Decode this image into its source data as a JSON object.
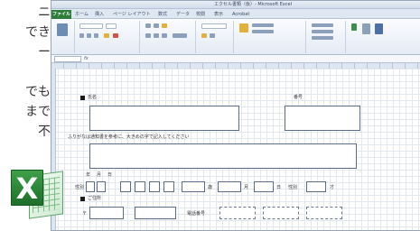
{
  "article": {
    "lines": [
      "ニ",
      "でき",
      "ー",
      "でも",
      "まで",
      "不"
    ]
  },
  "window": {
    "title": "エクセル書類（仮）- Microsoft Excel"
  },
  "ribbon_tabs": [
    "ファイル",
    "ホーム",
    "挿入",
    "ページ レイアウト",
    "数式",
    "データ",
    "校閲",
    "表示",
    "Acrobat"
  ],
  "form": {
    "section_name": "氏名",
    "section_number": "番号",
    "note": "ふりがなは通知書を参考に、大きめの字で記入してください",
    "date_labels": [
      "年",
      "月",
      "日"
    ],
    "row_label": "性別",
    "units": [
      "歳",
      "月",
      "日",
      "性別",
      "才"
    ],
    "section_address": "ご住所",
    "postal_mark": "〒",
    "phone_label": "電話番号"
  }
}
